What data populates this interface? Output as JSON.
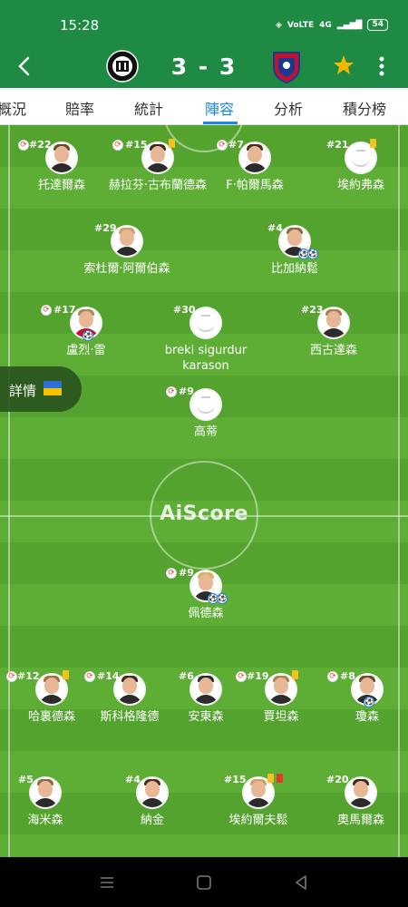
{
  "status": {
    "time": "15:28",
    "network": "4G",
    "battery": "54"
  },
  "match": {
    "score": "3 - 3"
  },
  "tabs": [
    "概況",
    "賠率",
    "統計",
    "陣容",
    "分析",
    "積分榜"
  ],
  "active_tab": "陣容",
  "watermark": "AiScore",
  "details_label": "詳情",
  "away_players": [
    {
      "num": "#22",
      "name": "托達爾森"
    },
    {
      "num": "#15",
      "name": "赫拉芬·古布蘭德森"
    },
    {
      "num": "#7",
      "name": "F·帕爾馬森"
    },
    {
      "num": "#21",
      "name": "埃約弗森"
    },
    {
      "num": "#29",
      "name": "索杜爾·阿爾伯森"
    },
    {
      "num": "#4",
      "name": "比加納鬆"
    },
    {
      "num": "#17",
      "name": "盧烈·雷"
    },
    {
      "num": "#30",
      "name": "breki sigurdur karason"
    },
    {
      "num": "#23",
      "name": "西古達森"
    },
    {
      "num": "#9",
      "name": "高蒂"
    }
  ],
  "home_players": [
    {
      "num": "#9",
      "name": "佩德森"
    },
    {
      "num": "#12",
      "name": "哈裏德森"
    },
    {
      "num": "#14",
      "name": "斯科格隆德"
    },
    {
      "num": "#6",
      "name": "安東森"
    },
    {
      "num": "#19",
      "name": "賈坦森"
    },
    {
      "num": "#8",
      "name": "瓊森"
    },
    {
      "num": "#5",
      "name": "海米森"
    },
    {
      "num": "#4",
      "name": "納金"
    },
    {
      "num": "#15",
      "name": "埃約爾夫鬆"
    },
    {
      "num": "#20",
      "name": "奧馬爾森"
    }
  ],
  "colors": {
    "header": "#1f8a43",
    "accent": "#1e88e5",
    "star": "#f5b700",
    "pitch": "#5eae35"
  }
}
